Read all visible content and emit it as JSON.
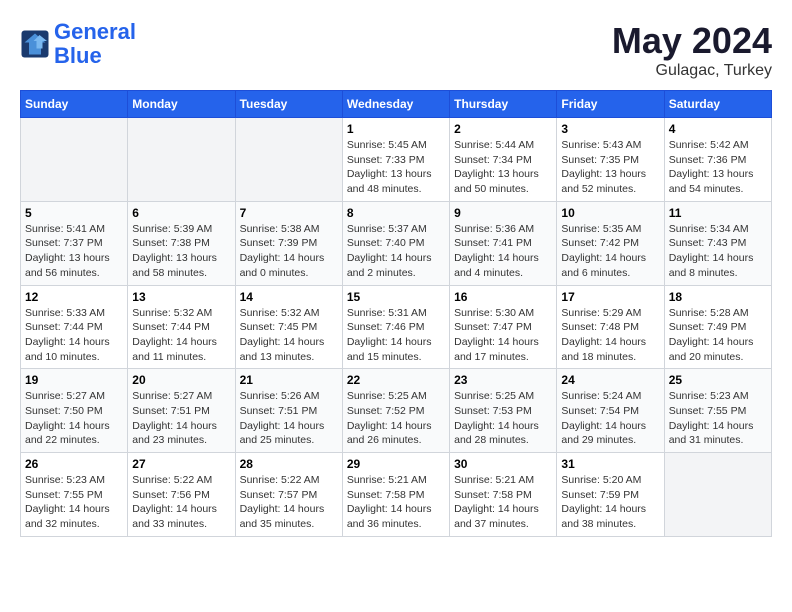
{
  "header": {
    "logo_line1": "General",
    "logo_line2": "Blue",
    "main_title": "May 2024",
    "subtitle": "Gulagac, Turkey"
  },
  "days_of_week": [
    "Sunday",
    "Monday",
    "Tuesday",
    "Wednesday",
    "Thursday",
    "Friday",
    "Saturday"
  ],
  "weeks": [
    [
      {
        "day": "",
        "sunrise": "",
        "sunset": "",
        "daylight": "",
        "empty": true
      },
      {
        "day": "",
        "sunrise": "",
        "sunset": "",
        "daylight": "",
        "empty": true
      },
      {
        "day": "",
        "sunrise": "",
        "sunset": "",
        "daylight": "",
        "empty": true
      },
      {
        "day": "1",
        "sunrise": "Sunrise: 5:45 AM",
        "sunset": "Sunset: 7:33 PM",
        "daylight": "Daylight: 13 hours and 48 minutes.",
        "empty": false
      },
      {
        "day": "2",
        "sunrise": "Sunrise: 5:44 AM",
        "sunset": "Sunset: 7:34 PM",
        "daylight": "Daylight: 13 hours and 50 minutes.",
        "empty": false
      },
      {
        "day": "3",
        "sunrise": "Sunrise: 5:43 AM",
        "sunset": "Sunset: 7:35 PM",
        "daylight": "Daylight: 13 hours and 52 minutes.",
        "empty": false
      },
      {
        "day": "4",
        "sunrise": "Sunrise: 5:42 AM",
        "sunset": "Sunset: 7:36 PM",
        "daylight": "Daylight: 13 hours and 54 minutes.",
        "empty": false
      }
    ],
    [
      {
        "day": "5",
        "sunrise": "Sunrise: 5:41 AM",
        "sunset": "Sunset: 7:37 PM",
        "daylight": "Daylight: 13 hours and 56 minutes.",
        "empty": false
      },
      {
        "day": "6",
        "sunrise": "Sunrise: 5:39 AM",
        "sunset": "Sunset: 7:38 PM",
        "daylight": "Daylight: 13 hours and 58 minutes.",
        "empty": false
      },
      {
        "day": "7",
        "sunrise": "Sunrise: 5:38 AM",
        "sunset": "Sunset: 7:39 PM",
        "daylight": "Daylight: 14 hours and 0 minutes.",
        "empty": false
      },
      {
        "day": "8",
        "sunrise": "Sunrise: 5:37 AM",
        "sunset": "Sunset: 7:40 PM",
        "daylight": "Daylight: 14 hours and 2 minutes.",
        "empty": false
      },
      {
        "day": "9",
        "sunrise": "Sunrise: 5:36 AM",
        "sunset": "Sunset: 7:41 PM",
        "daylight": "Daylight: 14 hours and 4 minutes.",
        "empty": false
      },
      {
        "day": "10",
        "sunrise": "Sunrise: 5:35 AM",
        "sunset": "Sunset: 7:42 PM",
        "daylight": "Daylight: 14 hours and 6 minutes.",
        "empty": false
      },
      {
        "day": "11",
        "sunrise": "Sunrise: 5:34 AM",
        "sunset": "Sunset: 7:43 PM",
        "daylight": "Daylight: 14 hours and 8 minutes.",
        "empty": false
      }
    ],
    [
      {
        "day": "12",
        "sunrise": "Sunrise: 5:33 AM",
        "sunset": "Sunset: 7:44 PM",
        "daylight": "Daylight: 14 hours and 10 minutes.",
        "empty": false
      },
      {
        "day": "13",
        "sunrise": "Sunrise: 5:32 AM",
        "sunset": "Sunset: 7:44 PM",
        "daylight": "Daylight: 14 hours and 11 minutes.",
        "empty": false
      },
      {
        "day": "14",
        "sunrise": "Sunrise: 5:32 AM",
        "sunset": "Sunset: 7:45 PM",
        "daylight": "Daylight: 14 hours and 13 minutes.",
        "empty": false
      },
      {
        "day": "15",
        "sunrise": "Sunrise: 5:31 AM",
        "sunset": "Sunset: 7:46 PM",
        "daylight": "Daylight: 14 hours and 15 minutes.",
        "empty": false
      },
      {
        "day": "16",
        "sunrise": "Sunrise: 5:30 AM",
        "sunset": "Sunset: 7:47 PM",
        "daylight": "Daylight: 14 hours and 17 minutes.",
        "empty": false
      },
      {
        "day": "17",
        "sunrise": "Sunrise: 5:29 AM",
        "sunset": "Sunset: 7:48 PM",
        "daylight": "Daylight: 14 hours and 18 minutes.",
        "empty": false
      },
      {
        "day": "18",
        "sunrise": "Sunrise: 5:28 AM",
        "sunset": "Sunset: 7:49 PM",
        "daylight": "Daylight: 14 hours and 20 minutes.",
        "empty": false
      }
    ],
    [
      {
        "day": "19",
        "sunrise": "Sunrise: 5:27 AM",
        "sunset": "Sunset: 7:50 PM",
        "daylight": "Daylight: 14 hours and 22 minutes.",
        "empty": false
      },
      {
        "day": "20",
        "sunrise": "Sunrise: 5:27 AM",
        "sunset": "Sunset: 7:51 PM",
        "daylight": "Daylight: 14 hours and 23 minutes.",
        "empty": false
      },
      {
        "day": "21",
        "sunrise": "Sunrise: 5:26 AM",
        "sunset": "Sunset: 7:51 PM",
        "daylight": "Daylight: 14 hours and 25 minutes.",
        "empty": false
      },
      {
        "day": "22",
        "sunrise": "Sunrise: 5:25 AM",
        "sunset": "Sunset: 7:52 PM",
        "daylight": "Daylight: 14 hours and 26 minutes.",
        "empty": false
      },
      {
        "day": "23",
        "sunrise": "Sunrise: 5:25 AM",
        "sunset": "Sunset: 7:53 PM",
        "daylight": "Daylight: 14 hours and 28 minutes.",
        "empty": false
      },
      {
        "day": "24",
        "sunrise": "Sunrise: 5:24 AM",
        "sunset": "Sunset: 7:54 PM",
        "daylight": "Daylight: 14 hours and 29 minutes.",
        "empty": false
      },
      {
        "day": "25",
        "sunrise": "Sunrise: 5:23 AM",
        "sunset": "Sunset: 7:55 PM",
        "daylight": "Daylight: 14 hours and 31 minutes.",
        "empty": false
      }
    ],
    [
      {
        "day": "26",
        "sunrise": "Sunrise: 5:23 AM",
        "sunset": "Sunset: 7:55 PM",
        "daylight": "Daylight: 14 hours and 32 minutes.",
        "empty": false
      },
      {
        "day": "27",
        "sunrise": "Sunrise: 5:22 AM",
        "sunset": "Sunset: 7:56 PM",
        "daylight": "Daylight: 14 hours and 33 minutes.",
        "empty": false
      },
      {
        "day": "28",
        "sunrise": "Sunrise: 5:22 AM",
        "sunset": "Sunset: 7:57 PM",
        "daylight": "Daylight: 14 hours and 35 minutes.",
        "empty": false
      },
      {
        "day": "29",
        "sunrise": "Sunrise: 5:21 AM",
        "sunset": "Sunset: 7:58 PM",
        "daylight": "Daylight: 14 hours and 36 minutes.",
        "empty": false
      },
      {
        "day": "30",
        "sunrise": "Sunrise: 5:21 AM",
        "sunset": "Sunset: 7:58 PM",
        "daylight": "Daylight: 14 hours and 37 minutes.",
        "empty": false
      },
      {
        "day": "31",
        "sunrise": "Sunrise: 5:20 AM",
        "sunset": "Sunset: 7:59 PM",
        "daylight": "Daylight: 14 hours and 38 minutes.",
        "empty": false
      },
      {
        "day": "",
        "sunrise": "",
        "sunset": "",
        "daylight": "",
        "empty": true
      }
    ]
  ]
}
